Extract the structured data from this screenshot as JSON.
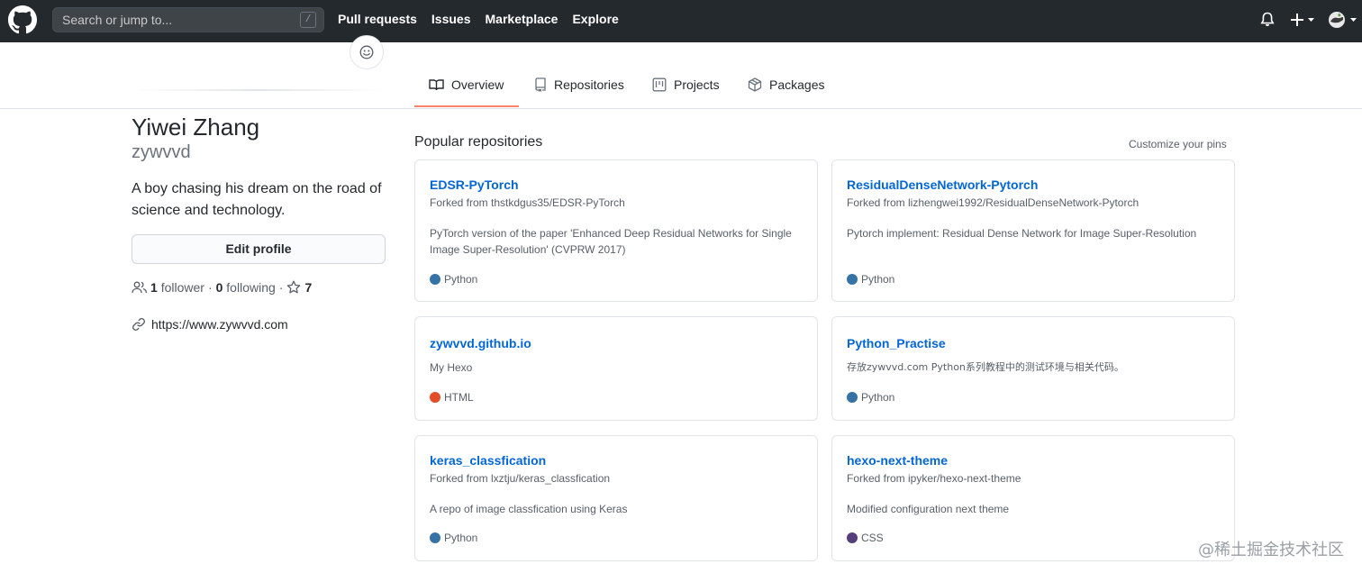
{
  "header": {
    "search_placeholder": "Search or jump to...",
    "search_shortcut": "/",
    "nav": [
      "Pull requests",
      "Issues",
      "Marketplace",
      "Explore"
    ],
    "icons": [
      "github-logo-icon",
      "bell-icon",
      "plus-icon",
      "avatar-icon"
    ]
  },
  "tabs": [
    {
      "label": "Overview",
      "icon": "book-icon",
      "selected": true
    },
    {
      "label": "Repositories",
      "icon": "repo-icon",
      "selected": false
    },
    {
      "label": "Projects",
      "icon": "project-icon",
      "selected": false
    },
    {
      "label": "Packages",
      "icon": "package-icon",
      "selected": false
    }
  ],
  "profile": {
    "full_name": "Yiwei Zhang",
    "login": "zywvvd",
    "bio": "A boy chasing his dream on the road of science and technology.",
    "edit_label": "Edit profile",
    "followers_count": "1",
    "followers_label": "follower",
    "separator": "·",
    "following_count": "0",
    "following_label": "following",
    "stars_count": "7",
    "website": "https://www.zywvvd.com"
  },
  "main": {
    "section_title": "Popular repositories",
    "customize_label": "Customize your pins",
    "repos": [
      {
        "name": "EDSR-PyTorch",
        "fork": "Forked from thstkdgus35/EDSR-PyTorch",
        "desc": "PyTorch version of the paper 'Enhanced Deep Residual Networks for Single Image Super-Resolution' (CVPRW 2017)",
        "lang": "Python",
        "lang_color": "#3572A5"
      },
      {
        "name": "ResidualDenseNetwork-Pytorch",
        "fork": "Forked from lizhengwei1992/ResidualDenseNetwork-Pytorch",
        "desc": "Pytorch implement: Residual Dense Network for Image Super-Resolution",
        "lang": "Python",
        "lang_color": "#3572A5"
      },
      {
        "name": "zywvvd.github.io",
        "fork": "",
        "desc": "My Hexo",
        "lang": "HTML",
        "lang_color": "#e34c26"
      },
      {
        "name": "Python_Practise",
        "fork": "",
        "desc": "存放zywvvd.com Python系列教程中的测试环境与相关代码。",
        "lang": "Python",
        "lang_color": "#3572A5"
      },
      {
        "name": "keras_classfication",
        "fork": "Forked from lxztju/keras_classfication",
        "desc": "A repo of image classfication using Keras",
        "lang": "Python",
        "lang_color": "#3572A5"
      },
      {
        "name": "hexo-next-theme",
        "fork": "Forked from ipyker/hexo-next-theme",
        "desc": "Modified configuration next theme",
        "lang": "CSS",
        "lang_color": "#563d7c"
      }
    ]
  },
  "watermark": "@稀土掘金技术社区"
}
